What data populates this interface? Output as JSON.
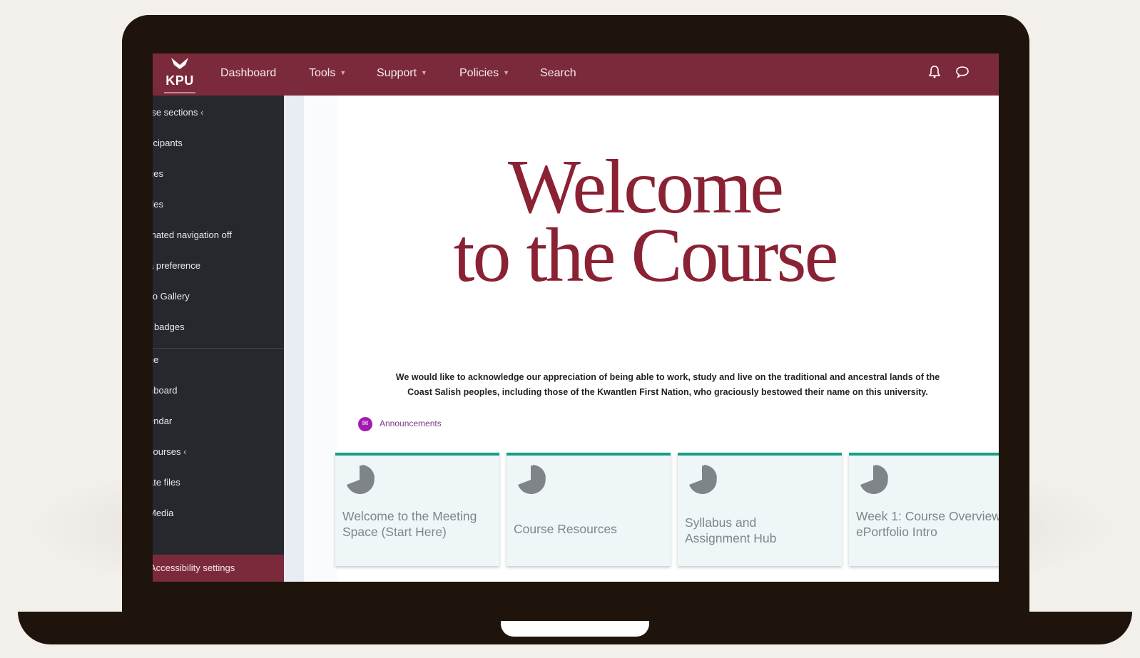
{
  "app": {
    "logo_text": "KPU",
    "logo_mark": "bird-logo"
  },
  "topnav": {
    "items": [
      {
        "label": "Dashboard",
        "dropdown": false
      },
      {
        "label": "Tools",
        "dropdown": true
      },
      {
        "label": "Support",
        "dropdown": true
      },
      {
        "label": "Policies",
        "dropdown": true
      },
      {
        "label": "Search",
        "dropdown": false
      }
    ],
    "icons": [
      "bell-icon",
      "chat-icon"
    ]
  },
  "sidebar": {
    "items": [
      {
        "label": "rse sections",
        "chevron": "‹"
      },
      {
        "label": "ticipants",
        "chevron": ""
      },
      {
        "label": "ges",
        "chevron": ""
      },
      {
        "label": "des",
        "chevron": ""
      },
      {
        "label": "mated navigation off",
        "chevron": ""
      },
      {
        "label": "a preference",
        "chevron": ""
      },
      {
        "label": "lio Gallery",
        "chevron": ""
      },
      {
        "label": "r badges",
        "chevron": ""
      },
      {
        "label": "ne",
        "chevron": ""
      },
      {
        "label": "hboard",
        "chevron": ""
      },
      {
        "label": "endar",
        "chevron": ""
      },
      {
        "label": "courses",
        "chevron": "‹"
      },
      {
        "label": "ate files",
        "chevron": ""
      },
      {
        "label": "Media",
        "chevron": ""
      }
    ],
    "footer_label": "Accessibility settings"
  },
  "main": {
    "title_line1": "Welcome",
    "title_line2": "to the Course",
    "acknowledgement_line1": "We would like to acknowledge our appreciation of being able to work, study and live on the traditional and ancestral lands of the",
    "acknowledgement_line2": "Coast Salish peoples, including those of the Kwantlen First Nation, who graciously bestowed their name on this university.",
    "announcements_label": "Announcements",
    "cards": [
      {
        "label": "Welcome to the Meeting Space (Start Here)",
        "icon": "pie-chart-icon"
      },
      {
        "label": "Course Resources",
        "icon": "pie-chart-icon"
      },
      {
        "label": "Syllabus and Assignment Hub",
        "icon": "pie-chart-icon"
      },
      {
        "label": "Week 1: Course Overview; ePortfolio Intro",
        "icon": "pie-chart-icon"
      }
    ]
  },
  "colors": {
    "brand_maroon": "#7b2a3c",
    "title_red": "#8a2234",
    "sidebar_dark": "#26282e",
    "card_accent": "#14a087",
    "laptop_body": "#1f140b"
  }
}
